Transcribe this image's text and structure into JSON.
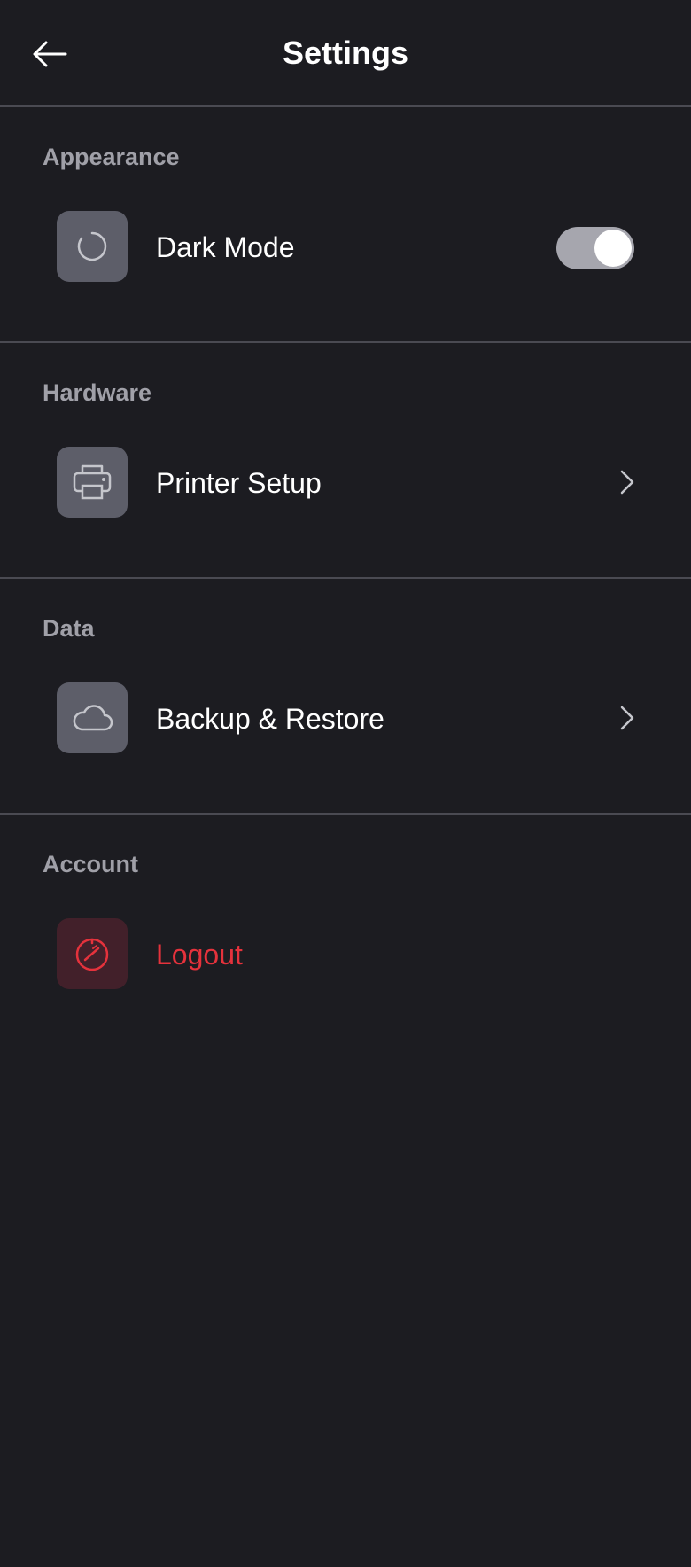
{
  "header": {
    "title": "Settings",
    "back_icon": "arrow-left-icon"
  },
  "sections": [
    {
      "label": "Appearance",
      "item": {
        "label": "Dark Mode",
        "icon": "theme-spinner-icon",
        "control": "toggle",
        "toggle_on": true
      }
    },
    {
      "label": "Hardware",
      "item": {
        "label": "Printer Setup",
        "icon": "printer-icon",
        "control": "chevron"
      }
    },
    {
      "label": "Data",
      "item": {
        "label": "Backup & Restore",
        "icon": "cloud-icon",
        "control": "chevron"
      }
    },
    {
      "label": "Account",
      "item": {
        "label": "Logout",
        "icon": "gauge-icon",
        "control": "none"
      }
    }
  ],
  "colors": {
    "background": "#1c1c21",
    "divider": "#4a4a52",
    "section_label": "#a0a0a8",
    "icon_tile": "#5d5e69",
    "icon_glyph": "#c5c6cc",
    "danger": "#e5323c",
    "danger_tile": "#42202a",
    "toggle_track": "#a6a6ae"
  }
}
